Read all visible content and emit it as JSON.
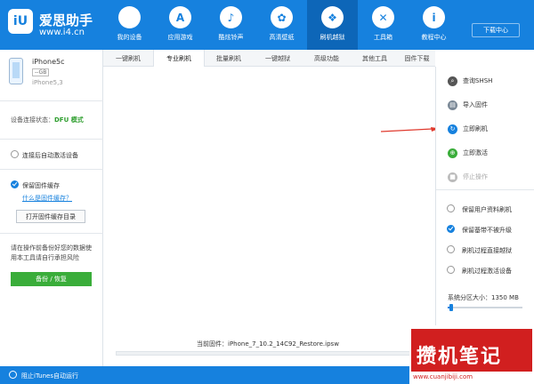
{
  "app": {
    "logo_glyph": "iU",
    "name": "爱思助手",
    "url": "www.i4.cn",
    "brand_color": "#1681de"
  },
  "nav": [
    {
      "label": "我的设备",
      "icon": "apple-icon",
      "glyph": "",
      "active": false
    },
    {
      "label": "应用游戏",
      "icon": "app-store-icon",
      "glyph": "A",
      "active": false
    },
    {
      "label": "酷炫铃声",
      "icon": "bell-icon",
      "glyph": "♪",
      "active": false
    },
    {
      "label": "高清壁纸",
      "icon": "flower-icon",
      "glyph": "✿",
      "active": false
    },
    {
      "label": "刷机越狱",
      "icon": "dropbox-icon",
      "glyph": "❖",
      "active": true
    },
    {
      "label": "工具箱",
      "icon": "tools-icon",
      "glyph": "✕",
      "active": false
    },
    {
      "label": "教程中心",
      "icon": "info-icon",
      "glyph": "i",
      "active": false
    }
  ],
  "header": {
    "download_label": "下载中心"
  },
  "device": {
    "name": "iPhone5c",
    "storage": "--GB",
    "model": "iPhone5,3"
  },
  "sidebar": {
    "conn_label": "设备连接状态：",
    "conn_state": "DFU 模式",
    "auto_activate_label": "连接后自动激活设备",
    "keep_firmware_label": "保留固件缓存",
    "what_is_cache_link": "什么是固件缓存？",
    "open_cache_dir_button": "打开固件缓存目录",
    "backup_note": "请在操作前备份好您的数据使用本工具请自行承担风险",
    "backup_button": "备份 / 恢复"
  },
  "tabs": [
    {
      "label": "一键刷机",
      "active": false
    },
    {
      "label": "专业刷机",
      "active": true
    },
    {
      "label": "批量刷机",
      "active": false
    },
    {
      "label": "一键越狱",
      "active": false
    },
    {
      "label": "高级功能",
      "active": false
    },
    {
      "label": "其他工具",
      "active": false
    },
    {
      "label": "固件下载",
      "active": false
    }
  ],
  "main": {
    "current_firmware_label": "当前固件：iPhone_7_10.2_14C92_Restore.ipsw",
    "progress": 0.0
  },
  "actions": [
    {
      "label": "查询SHSH",
      "icon": "search-icon",
      "glyph": "⌕",
      "color": "#555555",
      "enabled": true
    },
    {
      "label": "导入固件",
      "icon": "import-icon",
      "glyph": "▤",
      "color": "#7a8896",
      "enabled": true
    },
    {
      "label": "立即刷机",
      "icon": "flash-icon",
      "glyph": "↻",
      "color": "#1681de",
      "enabled": true
    },
    {
      "label": "立即激活",
      "icon": "globe-icon",
      "glyph": "⊕",
      "color": "#3aad3a",
      "enabled": true
    },
    {
      "label": "停止操作",
      "icon": "stop-icon",
      "glyph": "■",
      "color": "#bbbbbb",
      "enabled": false
    }
  ],
  "options": [
    {
      "label": "保留用户资料刷机",
      "checked": false
    },
    {
      "label": "保留基带不被升级",
      "checked": true
    },
    {
      "label": "刷机过程直接越狱",
      "checked": false
    },
    {
      "label": "刷机过程激活设备",
      "checked": false
    }
  ],
  "partition": {
    "label": "系统分区大小：1350 MB",
    "level": 0.05
  },
  "statusbar": {
    "itunes_label": "阻止iTunes自动运行"
  },
  "watermark": {
    "text": "攒机笔记",
    "url": "www.cuanjibiji.com"
  },
  "accent_arrow_color": "#e03a2e"
}
